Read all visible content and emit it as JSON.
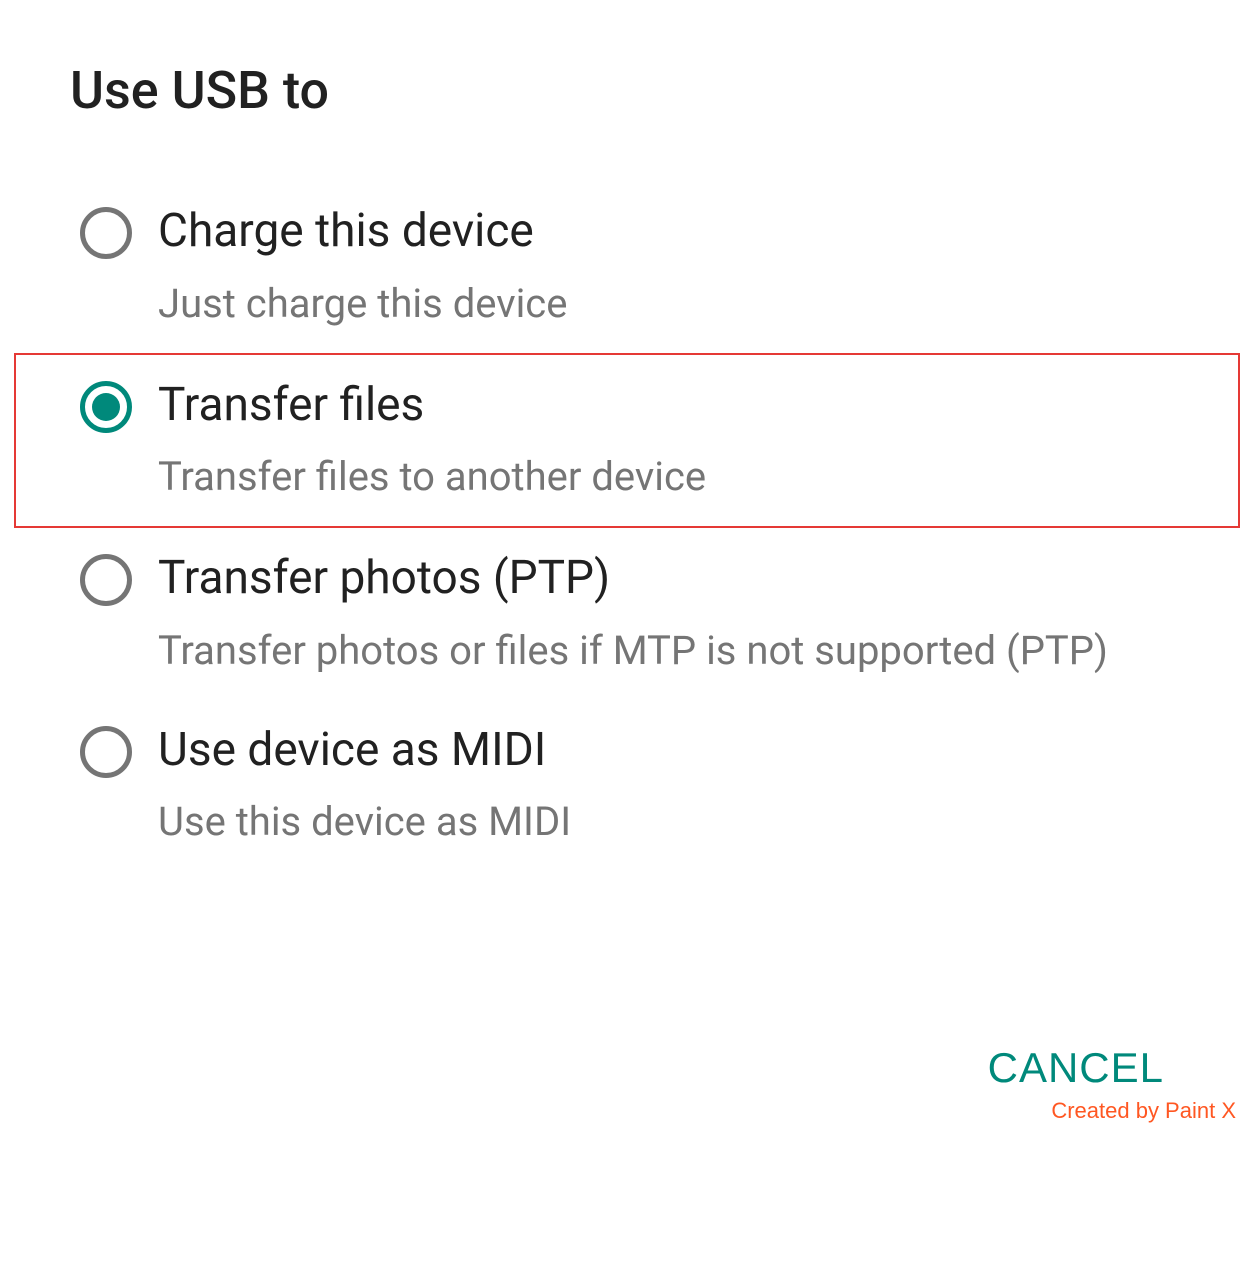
{
  "dialog": {
    "title": "Use USB to",
    "cancel_label": "CANCEL",
    "options": [
      {
        "label": "Charge this device",
        "description": "Just charge this device",
        "selected": false,
        "highlighted": false
      },
      {
        "label": "Transfer files",
        "description": "Transfer files to another device",
        "selected": true,
        "highlighted": true
      },
      {
        "label": "Transfer photos (PTP)",
        "description": "Transfer photos or files if MTP is not supported (PTP)",
        "selected": false,
        "highlighted": false
      },
      {
        "label": "Use device as MIDI",
        "description": "Use this device as MIDI",
        "selected": false,
        "highlighted": false
      }
    ]
  },
  "watermark": "Created by Paint X",
  "colors": {
    "accent": "#00897b",
    "highlight_border": "#e53935",
    "text_primary": "#212121",
    "text_secondary": "#757575"
  }
}
